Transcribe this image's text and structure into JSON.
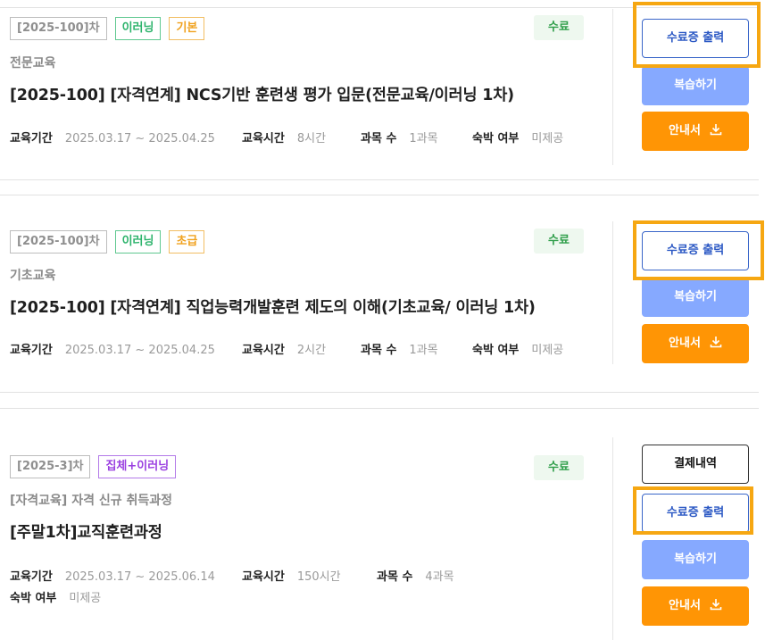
{
  "courses": [
    {
      "round": "[2025-100]차",
      "tags": [
        "이러닝",
        "기본"
      ],
      "status": "수료",
      "category": "전문교육",
      "title": "[2025-100] [자격연계] NCS기반 훈련생 평가 입문(전문교육/이러닝 1차)",
      "period_label": "교육기간",
      "period": "2025.03.17 ~ 2025.04.25",
      "hours_label": "교육시간",
      "hours": "8시간",
      "subjects_label": "과목 수",
      "subjects": "1과목",
      "lodging_label": "숙박 여부",
      "lodging": "미제공",
      "buttons": {
        "certificate": "수료증 출력",
        "review": "복습하기",
        "guide": "안내서"
      }
    },
    {
      "round": "[2025-100]차",
      "tags": [
        "이러닝",
        "초급"
      ],
      "status": "수료",
      "category": "기초교육",
      "title": "[2025-100] [자격연계] 직업능력개발훈련 제도의 이해(기초교육/ 이러닝 1차)",
      "period_label": "교육기간",
      "period": "2025.03.17 ~ 2025.04.25",
      "hours_label": "교육시간",
      "hours": "2시간",
      "subjects_label": "과목 수",
      "subjects": "1과목",
      "lodging_label": "숙박 여부",
      "lodging": "미제공",
      "buttons": {
        "certificate": "수료증 출력",
        "review": "복습하기",
        "guide": "안내서"
      }
    },
    {
      "round": "[2025-3]차",
      "tags": [
        "집체+이러닝"
      ],
      "status": "수료",
      "category": "[자격교육] 자격 신규 취득과정",
      "title": "[주말1차]교직훈련과정",
      "period_label": "교육기간",
      "period": "2025.03.17 ~ 2025.06.14",
      "hours_label": "교육시간",
      "hours": "150시간",
      "subjects_label": "과목 수",
      "subjects": "4과목",
      "lodging_label": "숙박 여부",
      "lodging": "미제공",
      "buttons": {
        "payment": "결제내역",
        "certificate": "수료증 출력",
        "review": "복습하기",
        "guide": "안내서"
      }
    }
  ],
  "colors": {
    "highlight": "#f6a712",
    "status_bg": "#eef8ef",
    "review_button": "#86a9ff",
    "guide_button": "#ff9505"
  },
  "icons": {
    "guide": "download-icon"
  }
}
